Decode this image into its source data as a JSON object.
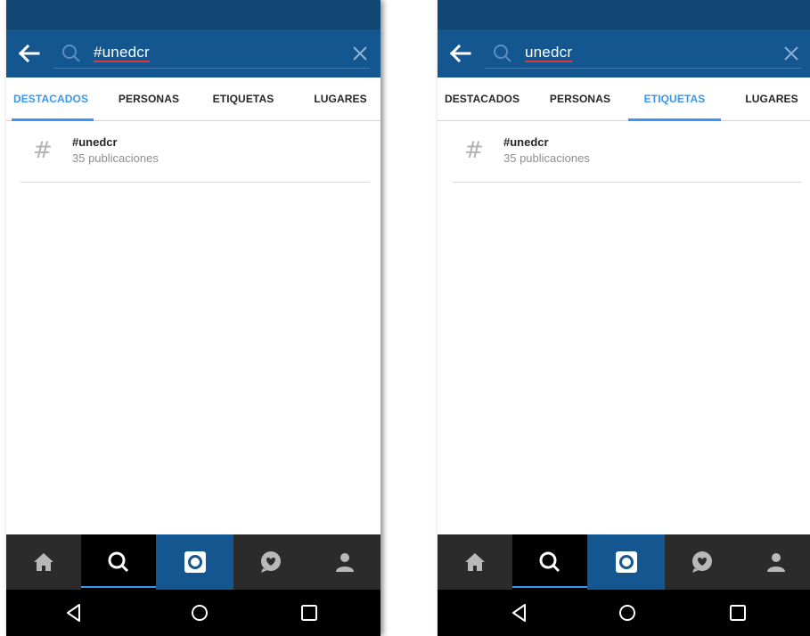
{
  "screens": [
    {
      "search": {
        "query": "#unedcr"
      },
      "tabs": [
        {
          "label": "DESTACADOS",
          "active": true
        },
        {
          "label": "PERSONAS",
          "active": false
        },
        {
          "label": "ETIQUETAS",
          "active": false
        },
        {
          "label": "LUGARES",
          "active": false
        }
      ],
      "results": [
        {
          "tag": "#unedcr",
          "count": "35 publicaciones"
        }
      ]
    },
    {
      "search": {
        "query": "unedcr"
      },
      "tabs": [
        {
          "label": "DESTACADOS",
          "active": false
        },
        {
          "label": "PERSONAS",
          "active": false
        },
        {
          "label": "ETIQUETAS",
          "active": true
        },
        {
          "label": "LUGARES",
          "active": false
        }
      ],
      "results": [
        {
          "tag": "#unedcr",
          "count": "35 publicaciones"
        }
      ]
    }
  ],
  "icons": {
    "header": [
      "back-arrow-icon",
      "search-icon",
      "close-icon"
    ],
    "result": "hashtag-icon",
    "bottom_nav": [
      "home-icon",
      "search-icon",
      "camera-icon",
      "heart-bubble-icon",
      "profile-icon"
    ],
    "system_nav": [
      "back-triangle-icon",
      "home-circle-icon",
      "recents-square-icon"
    ]
  },
  "colors": {
    "status_bar": "#124673",
    "search_bar": "#14568f",
    "active_tab": "#3897f0",
    "bottom_nav": "#2b2b2b",
    "typo_underline": "#e0363f"
  }
}
